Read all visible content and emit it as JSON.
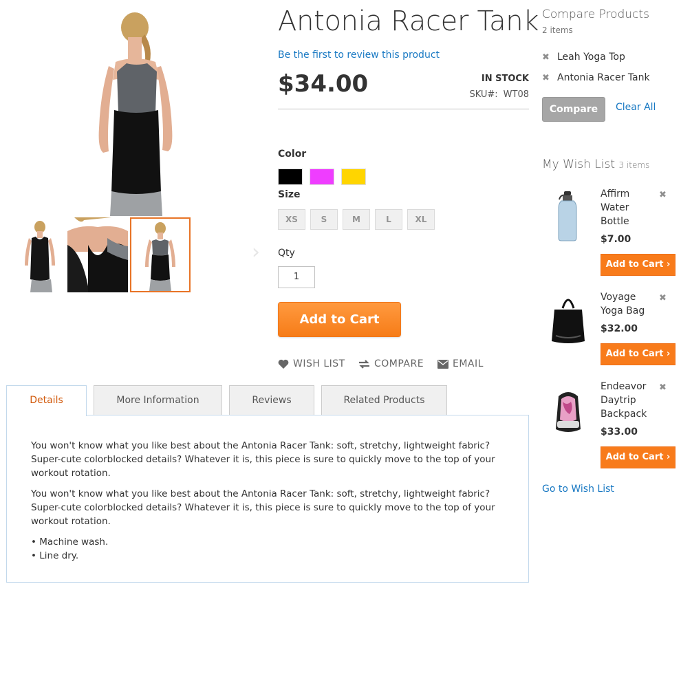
{
  "product": {
    "name": "Antonia Racer Tank",
    "review_link": "Be the first to review this product",
    "price": "$34.00",
    "stock": "IN STOCK",
    "sku_label": "SKU#:",
    "sku_value": "WT08",
    "color_label": "Color",
    "colors": [
      "#000000",
      "#ef3dff",
      "#ffd500"
    ],
    "size_label": "Size",
    "sizes": [
      "XS",
      "S",
      "M",
      "L",
      "XL"
    ],
    "qty_label": "Qty",
    "qty_value": "1",
    "add_to_cart": "Add to Cart",
    "actions": {
      "wishlist": "WISH LIST",
      "compare": "COMPARE",
      "email": "EMAIL"
    }
  },
  "gallery": {
    "prev_arrow": "‹",
    "next_arrow": "›"
  },
  "tabs": [
    {
      "label": "Details"
    },
    {
      "label": "More Information"
    },
    {
      "label": "Reviews"
    },
    {
      "label": "Related Products"
    }
  ],
  "details": {
    "paragraph_1": "You won't know what you like best about the Antonia Racer Tank: soft, stretchy, lightweight fabric? Super-cute colorblocked details? Whatever it is, this piece is sure to quickly move to the top of your workout rotation.",
    "paragraph_2": "You won't know what you like best about the Antonia Racer Tank: soft, stretchy, lightweight fabric? Super-cute colorblocked details? Whatever it is, this piece is sure to quickly move to the top of your workout rotation.",
    "bullets": [
      "• Machine wash.",
      "• Line dry."
    ]
  },
  "compare": {
    "title": "Compare Products",
    "count": "2 items",
    "items": [
      "Leah Yoga Top",
      "Antonia Racer Tank"
    ],
    "compare_button": "Compare",
    "clear_all": "Clear All"
  },
  "wishlist": {
    "title": "My Wish List",
    "count": "3 items",
    "items": [
      {
        "name": "Affirm Water Bottle",
        "price": "$7.00"
      },
      {
        "name": "Voyage Yoga Bag",
        "price": "$32.00"
      },
      {
        "name": "Endeavor Daytrip Backpack",
        "price": "$33.00"
      }
    ],
    "add_to_cart": "Add to Cart ›",
    "go_to_wishlist": "Go to Wish List"
  },
  "colors": {
    "accent_orange": "#f87b1b",
    "link_blue": "#1979c3",
    "active_tab_text": "#d25a0c"
  }
}
